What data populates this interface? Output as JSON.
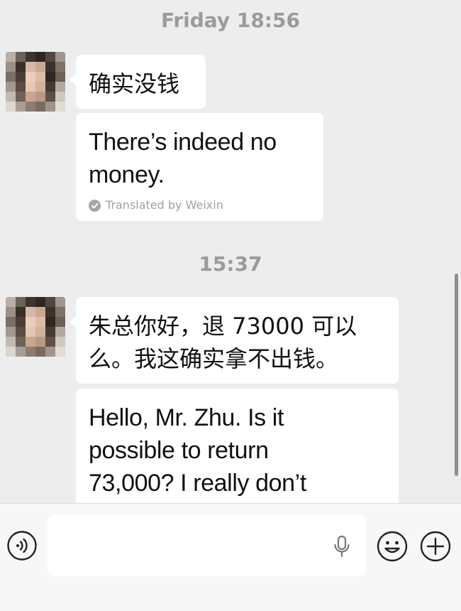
{
  "chat": {
    "timestamps": [
      "Friday 18:56",
      "15:37"
    ],
    "messages": [
      {
        "original": "确实没钱",
        "translation": "There’s indeed no money.",
        "translated_by": "Translated by Weixin"
      },
      {
        "original": "朱总你好，退 73000 可以么。我这确实拿不出钱。",
        "translation": "Hello, Mr. Zhu. Is it possible to return 73,000? I really don’t"
      }
    ]
  },
  "input_bar": {
    "text_value": "",
    "icons": [
      "voice-icon",
      "microphone-icon",
      "emoji-icon",
      "plus-icon"
    ]
  },
  "colors": {
    "background": "#ededed",
    "bubble": "#ffffff",
    "timestamp": "#9b9b9b",
    "input_bar": "#f7f7f7"
  }
}
